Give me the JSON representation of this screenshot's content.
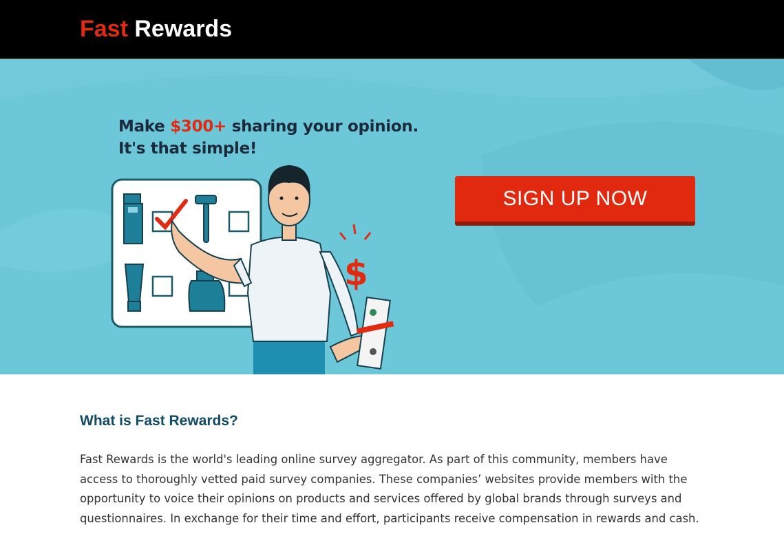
{
  "header": {
    "logo_part1": "Fast",
    "logo_part2": "Rewards"
  },
  "hero": {
    "headline_prefix": "Make ",
    "headline_amount": "$300+",
    "headline_suffix": " sharing your opinion.",
    "headline_line2": "It's that simple!",
    "cta_label": "SIGN UP NOW"
  },
  "about": {
    "title": "What is Fast Rewards?",
    "body": "Fast Rewards is the world's leading online survey aggregator. As part of this community, members have access to thoroughly vetted paid survey companies. These companies’ websites provide members with the opportunity to voice their opinions on products and services offered by global brands through surveys and questionnaires. In exchange for their time and effort, participants receive compensation in rewards and cash."
  },
  "colors": {
    "brand_red": "#e02b12",
    "header_bg": "#000000",
    "hero_bg": "#6cc7d8",
    "title_blue": "#114a66"
  },
  "icons": {
    "illustration": "man-with-survey-board-and-cash",
    "dollar": "dollar-sign-icon",
    "checkmark": "checkmark-icon"
  }
}
